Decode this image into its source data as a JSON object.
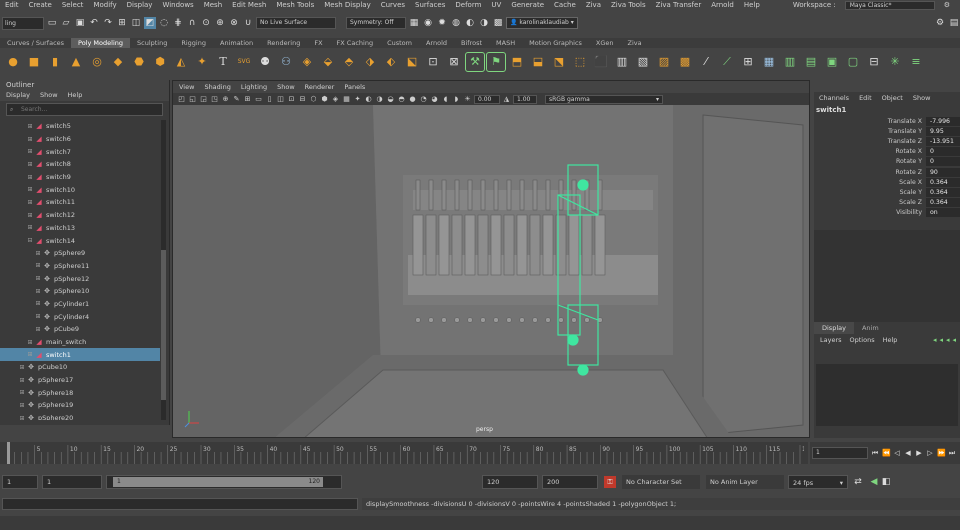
{
  "menubar": {
    "items": [
      "Edit",
      "Create",
      "Select",
      "Modify",
      "Display",
      "Windows",
      "Mesh",
      "Edit Mesh",
      "Mesh Tools",
      "Mesh Display",
      "Curves",
      "Surfaces",
      "Deform",
      "UV",
      "Generate",
      "Cache",
      "Ziva",
      "Ziva Tools",
      "Ziva Transfer",
      "Arnold",
      "Help"
    ],
    "workspace_label": "Workspace :",
    "workspace_value": "Maya Classic*"
  },
  "status": {
    "mode": "ling",
    "live_surface": "No Live Surface",
    "symmetry": "Symmetry: Off",
    "user": "karolinaklaudiab"
  },
  "shelf_tabs": [
    "Curves / Surfaces",
    "Poly Modeling",
    "Sculpting",
    "Rigging",
    "Animation",
    "Rendering",
    "FX",
    "FX Caching",
    "Custom",
    "Arnold",
    "Bifrost",
    "MASH",
    "Motion Graphics",
    "XGen",
    "Ziva"
  ],
  "shelf_active": "Poly Modeling",
  "outliner": {
    "title": "Outliner",
    "menu": [
      "Display",
      "Show",
      "Help"
    ],
    "search_placeholder": "Search...",
    "rows": [
      {
        "label": "switch5",
        "indent": 1,
        "icon": "mesh",
        "exp": "+"
      },
      {
        "label": "switch6",
        "indent": 1,
        "icon": "mesh",
        "exp": "+"
      },
      {
        "label": "switch7",
        "indent": 1,
        "icon": "mesh",
        "exp": "+"
      },
      {
        "label": "switch8",
        "indent": 1,
        "icon": "mesh",
        "exp": "+"
      },
      {
        "label": "switch9",
        "indent": 1,
        "icon": "mesh",
        "exp": "+"
      },
      {
        "label": "switch10",
        "indent": 1,
        "icon": "mesh",
        "exp": "+"
      },
      {
        "label": "switch11",
        "indent": 1,
        "icon": "mesh",
        "exp": "+"
      },
      {
        "label": "switch12",
        "indent": 1,
        "icon": "mesh",
        "exp": "+"
      },
      {
        "label": "switch13",
        "indent": 1,
        "icon": "mesh",
        "exp": "+"
      },
      {
        "label": "switch14",
        "indent": 1,
        "icon": "mesh",
        "exp": "−"
      },
      {
        "label": "pSphere9",
        "indent": 2,
        "icon": "tr",
        "exp": "+"
      },
      {
        "label": "pSphere11",
        "indent": 2,
        "icon": "tr",
        "exp": "+"
      },
      {
        "label": "pSphere12",
        "indent": 2,
        "icon": "tr",
        "exp": "+"
      },
      {
        "label": "pSphere10",
        "indent": 2,
        "icon": "tr",
        "exp": "+"
      },
      {
        "label": "pCylinder1",
        "indent": 2,
        "icon": "tr",
        "exp": "+"
      },
      {
        "label": "pCylinder4",
        "indent": 2,
        "icon": "tr",
        "exp": "+"
      },
      {
        "label": "pCube9",
        "indent": 2,
        "icon": "tr",
        "exp": "+"
      },
      {
        "label": "main_switch",
        "indent": 1,
        "icon": "mesh",
        "exp": "+"
      },
      {
        "label": "switch1",
        "indent": 1,
        "icon": "mesh",
        "exp": "+",
        "selected": true
      },
      {
        "label": "pCube10",
        "indent": 0,
        "icon": "tr",
        "exp": "+"
      },
      {
        "label": "pSphere17",
        "indent": 0,
        "icon": "tr",
        "exp": "+"
      },
      {
        "label": "pSphere18",
        "indent": 0,
        "icon": "tr",
        "exp": "+"
      },
      {
        "label": "pSphere19",
        "indent": 0,
        "icon": "tr",
        "exp": "+"
      },
      {
        "label": "pSphere20",
        "indent": 0,
        "icon": "tr",
        "exp": "+"
      }
    ]
  },
  "viewport": {
    "menu": [
      "View",
      "Shading",
      "Lighting",
      "Show",
      "Renderer",
      "Panels"
    ],
    "exposure": "0.00",
    "gamma": "1.00",
    "color_space": "sRGB gamma",
    "camera": "persp"
  },
  "channelbox": {
    "menu": [
      "Channels",
      "Edit",
      "Object",
      "Show"
    ],
    "object": "switch1",
    "attrs": [
      {
        "name": "Translate X",
        "value": "-7.996"
      },
      {
        "name": "Translate Y",
        "value": "9.95"
      },
      {
        "name": "Translate Z",
        "value": "-13.951"
      },
      {
        "name": "Rotate X",
        "value": "0"
      },
      {
        "name": "Rotate Y",
        "value": "0"
      },
      {
        "name": "Rotate Z",
        "value": "90"
      },
      {
        "name": "Scale X",
        "value": "0.364"
      },
      {
        "name": "Scale Y",
        "value": "0.364"
      },
      {
        "name": "Scale Z",
        "value": "0.364"
      },
      {
        "name": "Visibility",
        "value": "on"
      }
    ]
  },
  "layers": {
    "tabs": [
      "Display",
      "Anim"
    ],
    "menu": [
      "Layers",
      "Options",
      "Help"
    ]
  },
  "timeline": {
    "ticks": [
      "5",
      "10",
      "15",
      "20",
      "25",
      "30",
      "35",
      "40",
      "45",
      "50",
      "55",
      "60",
      "65",
      "70",
      "75",
      "80",
      "85",
      "90",
      "95",
      "100",
      "105",
      "110",
      "115",
      "120"
    ],
    "current_frame": "1"
  },
  "range": {
    "start": "1",
    "anim_start": "1",
    "slider_start": "1",
    "slider_end": "120",
    "anim_end": "120",
    "end": "200",
    "character_set": "No Character Set",
    "anim_layer": "No Anim Layer",
    "fps": "24 fps"
  },
  "command": {
    "feedback": "displaySmoothness -divisionsU 0 -divisionsV 0 -pointsWire 4 -pointsShaded 1 -polygonObject 1;"
  }
}
